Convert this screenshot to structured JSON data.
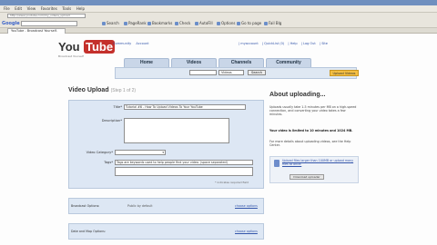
{
  "browser": {
    "menu": [
      "File",
      "Edit",
      "View",
      "Favorites",
      "Tools",
      "Help"
    ],
    "address": "http://www.youtube.com/my_videos_upload",
    "google_label": "Google",
    "toolbar_items": [
      "Search",
      "PageRank",
      "Bookmarks",
      "Check",
      "AutoFill",
      "Options",
      "Go to page",
      "Fail Blg"
    ],
    "tab_title": "YouTube - Broadcast Yourself."
  },
  "header": {
    "logo_you": "You",
    "logo_tube": "Tube",
    "tagline": "Broadcast Yourself",
    "top_links": [
      "Community",
      "Account"
    ],
    "user_links": [
      "| myaccount",
      "| QuickList (0)",
      "| Help",
      "| Log Out",
      "| Site"
    ],
    "nav_tabs": [
      "Home",
      "Videos",
      "Channels",
      "Community"
    ],
    "search_placeholder": "",
    "search_scope": "Videos",
    "search_button": "Search",
    "upload_button": "Upload Videos"
  },
  "upload": {
    "title": "Video Upload",
    "step": "(Step 1 of 2)",
    "labels": {
      "title": "Title*",
      "description": "Description*",
      "category": "Video Category*",
      "tags": "Tags*"
    },
    "title_value": "Tutorial #6 - How To Upload Videos To Your YouTube",
    "description_value": "",
    "category_value": "",
    "tags_value": "Tags are keywords used to help people find your video.  (space separated)",
    "tags_note": "* indicates required field",
    "options": [
      {
        "name": "Broadcast Options:",
        "value": "Public by default",
        "link": "choose options"
      },
      {
        "name": "Date and Map Options:",
        "value": "",
        "link": "choose options"
      }
    ]
  },
  "about": {
    "title": "About uploading...",
    "intro": "Uploads usually take 1-5 minutes per MB on a high-speed connection, and converting your video takes a few minutes.",
    "limit": "Your video is limited to 10 minutes and 1024 MB.",
    "help": "For more details about uploading videos, see the Help Center.",
    "download_text": "Upload files larger than 100MB or upload many files at once:",
    "download_button": "Download uploader"
  }
}
